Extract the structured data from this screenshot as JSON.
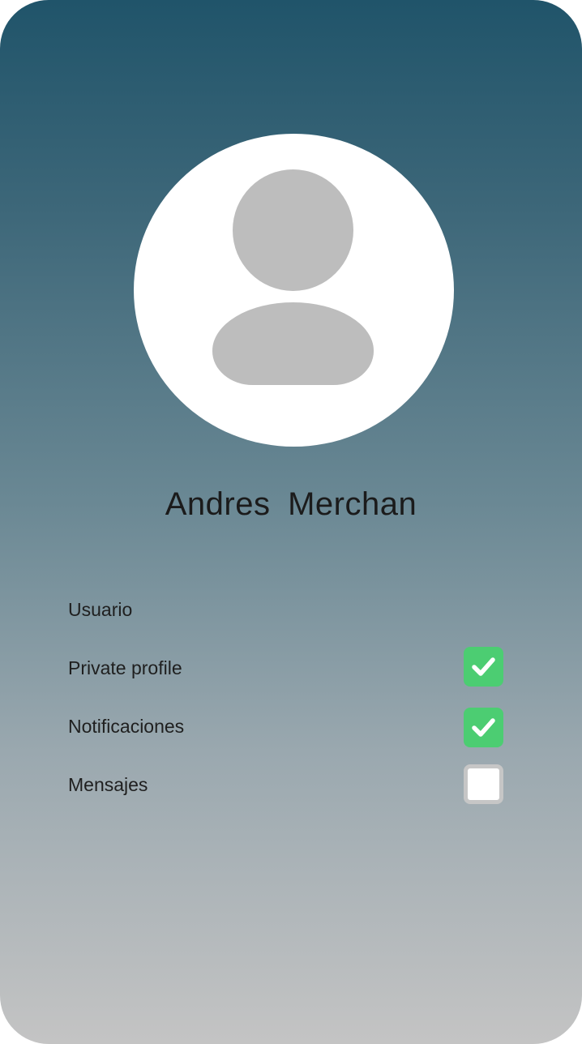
{
  "profile": {
    "name": "Andres  Merchan"
  },
  "settings": {
    "user_label": "Usuario",
    "private_profile": {
      "label": "Private profile",
      "checked": true
    },
    "notifications": {
      "label": "Notificaciones",
      "checked": true
    },
    "messages": {
      "label": "Mensajes",
      "checked": false
    }
  },
  "colors": {
    "gradient_top": "#20546a",
    "gradient_bottom": "#c4c4c4",
    "checkbox_checked": "#4ccd72",
    "checkbox_unchecked_border": "#c6c6c6",
    "avatar_placeholder": "#bdbdbd"
  },
  "icons": {
    "avatar": "user-placeholder-icon",
    "check": "checkmark-icon"
  }
}
